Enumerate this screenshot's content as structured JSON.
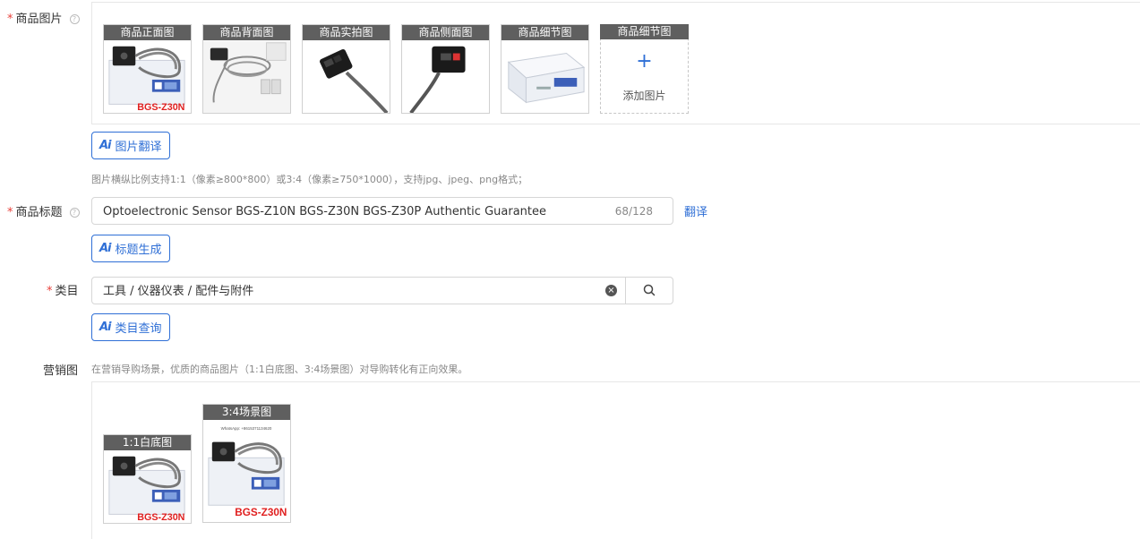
{
  "images_field": {
    "required_mark": "*",
    "label": "商品图片",
    "help": "?",
    "thumbnails": [
      {
        "caption": "商品正面图",
        "model_text": "BGS-Z30N"
      },
      {
        "caption": "商品背面图"
      },
      {
        "caption": "商品实拍图"
      },
      {
        "caption": "商品侧面图"
      },
      {
        "caption": "商品细节图"
      }
    ],
    "add_tile": {
      "caption": "商品细节图",
      "plus": "+",
      "text": "添加图片"
    },
    "ai_button": {
      "icon": "Ai",
      "label": "图片翻译"
    },
    "hint": "图片横纵比例支持1:1（像素≥800*800）或3:4（像素≥750*1000），支持jpg、jpeg、png格式；"
  },
  "title_field": {
    "required_mark": "*",
    "label": "商品标题",
    "help": "?",
    "value": "Optoelectronic Sensor BGS-Z10N BGS-Z30N BGS-Z30P Authentic Guarantee",
    "counter": "68/128",
    "translate_link": "翻译",
    "ai_button": {
      "icon": "Ai",
      "label": "标题生成"
    }
  },
  "category_field": {
    "required_mark": "*",
    "label": "类目",
    "value": "工具 / 仪器仪表 / 配件与附件",
    "clear": "×",
    "ai_button": {
      "icon": "Ai",
      "label": "类目查询"
    }
  },
  "marketing_field": {
    "label": "营销图",
    "hint": "在营销导购场景，优质的商品图片（1:1白底图、3:4场景图）对导购转化有正向效果。",
    "thumbnails": [
      {
        "caption": "1:1白底图",
        "model_text": "BGS-Z30N"
      },
      {
        "caption": "3:4场景图",
        "model_text": "BGS-Z30N",
        "small_text": "WhatsApp: +8615371134620"
      }
    ]
  },
  "colors": {
    "accent": "#2f6fd6",
    "required": "#e8403a",
    "caption_bg": "#5f5f5f",
    "model_red": "#e02020"
  }
}
